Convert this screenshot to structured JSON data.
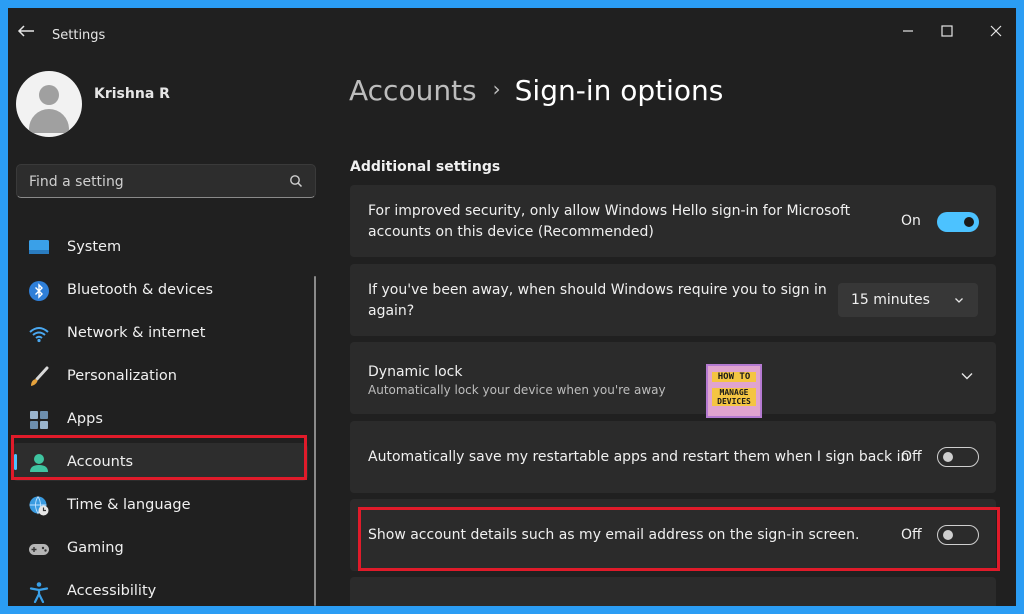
{
  "window": {
    "title": "Settings",
    "controls": [
      "minimize",
      "maximize",
      "close"
    ]
  },
  "user": {
    "name": "Krishna R"
  },
  "search": {
    "placeholder": "Find a setting"
  },
  "nav": {
    "items": [
      {
        "label": "System",
        "icon": "system-monitor-icon"
      },
      {
        "label": "Bluetooth & devices",
        "icon": "bluetooth-icon"
      },
      {
        "label": "Network & internet",
        "icon": "wifi-icon"
      },
      {
        "label": "Personalization",
        "icon": "paint-brush-icon"
      },
      {
        "label": "Apps",
        "icon": "apps-icon"
      },
      {
        "label": "Accounts",
        "icon": "person-icon",
        "active": true
      },
      {
        "label": "Time & language",
        "icon": "globe-clock-icon"
      },
      {
        "label": "Gaming",
        "icon": "gamepad-icon"
      },
      {
        "label": "Accessibility",
        "icon": "accessibility-icon"
      }
    ]
  },
  "header": {
    "breadcrumb_parent": "Accounts",
    "breadcrumb_separator": "›",
    "page_title": "Sign-in options"
  },
  "section": {
    "title": "Additional settings"
  },
  "settings": {
    "hello_only": {
      "text_line1": "For improved security, only allow Windows Hello sign-in for Microsoft",
      "text_line2": "accounts on this device (Recommended)",
      "state": "On"
    },
    "require_signin": {
      "text_line1": "If you've been away, when should Windows require you to sign in",
      "text_line2": "again?",
      "value": "15 minutes"
    },
    "dynamic_lock": {
      "title": "Dynamic lock",
      "subtitle": "Automatically lock your device when you're away"
    },
    "restart_apps": {
      "text": "Automatically save my restartable apps and restart them when I sign back in",
      "state": "Off"
    },
    "account_details": {
      "text": "Show account details such as my email address on the sign-in screen.",
      "state": "Off"
    }
  },
  "logo": {
    "line1": "HOW TO",
    "line2": "MANAGE DEVICES"
  },
  "colors": {
    "accent": "#4cc2ff",
    "highlight_border": "#e01b2a",
    "window_bg": "#202020",
    "card_bg": "#2b2b2b",
    "frame": "#2b9df4"
  }
}
